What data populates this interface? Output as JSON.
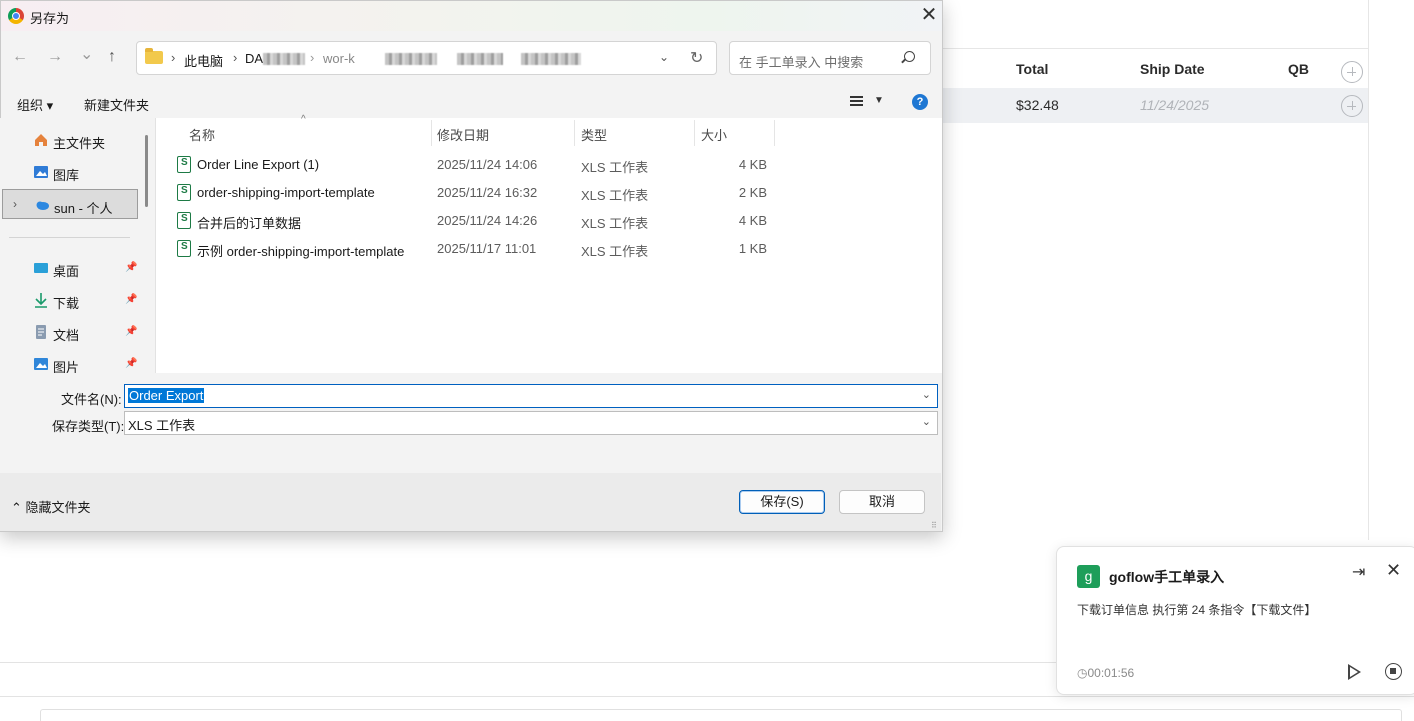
{
  "background_page": {
    "table_headers": [
      "Total",
      "Ship Date",
      "QB"
    ],
    "row": {
      "total": "$32.48",
      "ship_date": "11/24/2025"
    }
  },
  "dialog": {
    "title": "另存为",
    "close_glyph": "✕",
    "nav": {
      "back": "←",
      "forward": "→",
      "recent": "⌄",
      "up": "↑"
    },
    "address": {
      "segments": [
        "此电脑",
        "DA"
      ],
      "blurred_suffix": "wor-k",
      "separator": "›"
    },
    "search_placeholder": "在 手工单录入 中搜索",
    "toolbar": {
      "organize": "组织 ▾",
      "new_folder": "新建文件夹"
    },
    "help_glyph": "?",
    "sidebar": {
      "items": [
        {
          "label": "主文件夹",
          "icon": "home-icon"
        },
        {
          "label": "图库",
          "icon": "gallery-icon"
        },
        {
          "label": "sun - 个人",
          "icon": "cloud-icon",
          "selected": true
        },
        {
          "label": "桌面",
          "icon": "desktop-icon",
          "pinned": true
        },
        {
          "label": "下载",
          "icon": "download-icon",
          "pinned": true
        },
        {
          "label": "文档",
          "icon": "document-icon",
          "pinned": true
        },
        {
          "label": "图片",
          "icon": "pictures-icon",
          "pinned": true
        }
      ]
    },
    "columns": {
      "name": "名称",
      "modified": "修改日期",
      "type": "类型",
      "size": "大小"
    },
    "files": [
      {
        "name": "Order Line Export (1)",
        "modified": "2025/11/24 14:06",
        "type": "XLS 工作表",
        "size": "4 KB"
      },
      {
        "name": "order-shipping-import-template",
        "modified": "2025/11/24 16:32",
        "type": "XLS 工作表",
        "size": "2 KB"
      },
      {
        "name": "合并后的订单数据",
        "modified": "2025/11/24 14:26",
        "type": "XLS 工作表",
        "size": "4 KB"
      },
      {
        "name": "示例 order-shipping-import-template",
        "modified": "2025/11/17 11:01",
        "type": "XLS 工作表",
        "size": "1 KB"
      }
    ],
    "filename_label": "文件名(N):",
    "filename_value": "Order Export",
    "filetype_label": "保存类型(T):",
    "filetype_value": "XLS 工作表",
    "hide_folders": "隐藏文件夹",
    "save_button": "保存(S)",
    "cancel_button": "取消"
  },
  "toast": {
    "logo_letter": "g",
    "title": "goflow手工单录入",
    "body": "下载订单信息 执行第 24 条指令【下载文件】",
    "time": "00:01:56"
  },
  "colors": {
    "accent": "#0078d7",
    "toast_brand": "#1e9e5a"
  }
}
